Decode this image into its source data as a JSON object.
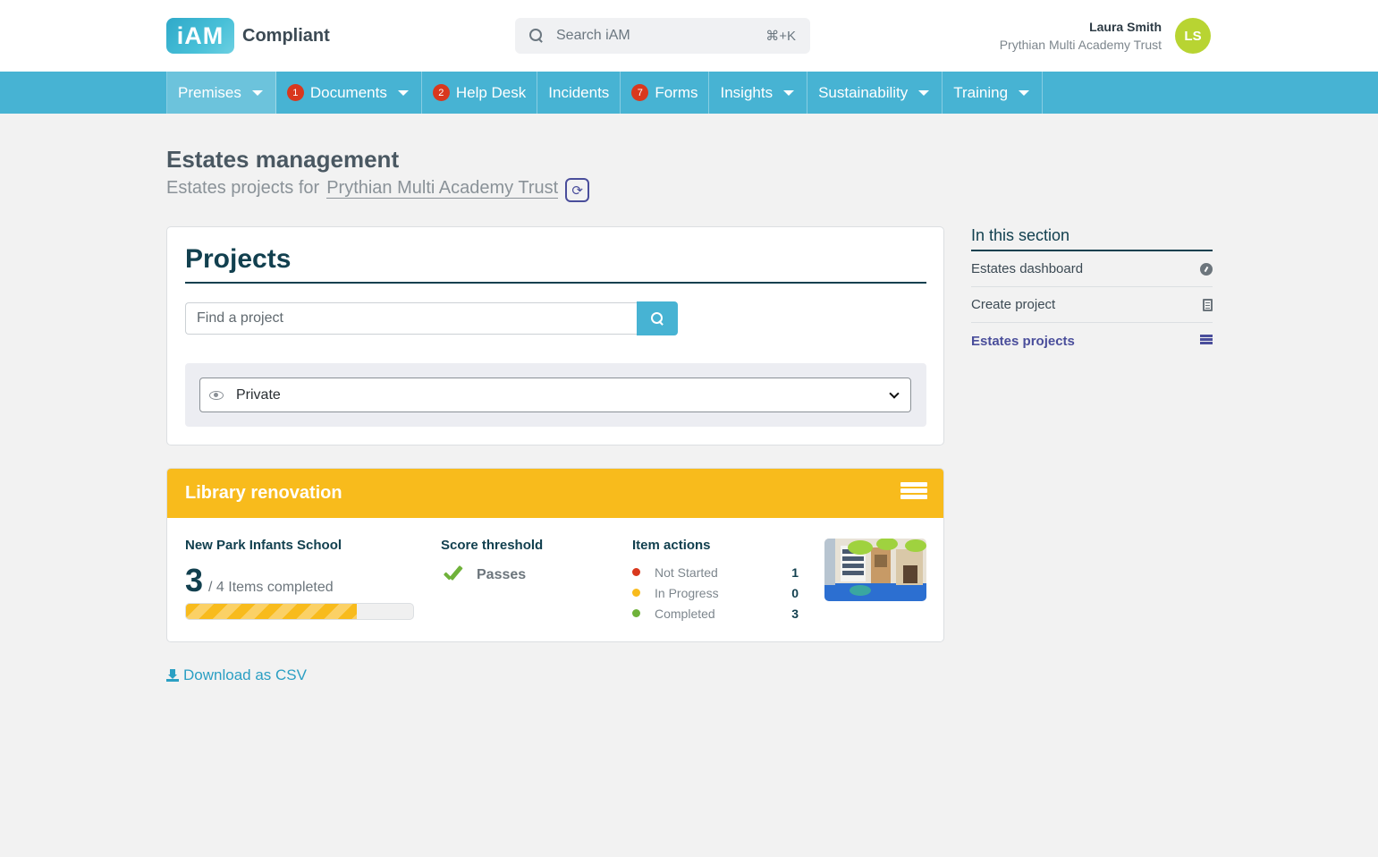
{
  "header": {
    "logo_mark": "iAM",
    "logo_text": "Compliant",
    "search_placeholder": "Search iAM",
    "search_shortcut": "⌘+K",
    "user_name": "Laura Smith",
    "user_org": "Prythian Multi Academy Trust",
    "avatar_initials": "LS"
  },
  "nav": {
    "items": [
      {
        "label": "Premises",
        "badge": "",
        "caret": true
      },
      {
        "label": "Documents",
        "badge": "1",
        "caret": true
      },
      {
        "label": "Help Desk",
        "badge": "2",
        "caret": false
      },
      {
        "label": "Incidents",
        "badge": "",
        "caret": false
      },
      {
        "label": "Forms",
        "badge": "7",
        "caret": false
      },
      {
        "label": "Insights",
        "badge": "",
        "caret": true
      },
      {
        "label": "Sustainability",
        "badge": "",
        "caret": true
      },
      {
        "label": "Training",
        "badge": "",
        "caret": true
      }
    ]
  },
  "page": {
    "title": "Estates management",
    "subtitle_prefix": "Estates projects for",
    "subtitle_org": "Prythian Multi Academy Trust"
  },
  "projects": {
    "heading": "Projects",
    "search_placeholder": "Find a project",
    "visibility_selected": "Private"
  },
  "project_card": {
    "title": "Library renovation",
    "school": "New Park Infants School",
    "completed": "3",
    "total_text": "/ 4 Items completed",
    "progress_fraction": 0.75,
    "threshold_title": "Score threshold",
    "threshold_status": "Passes",
    "actions_title": "Item actions",
    "actions": [
      {
        "label": "Not Started",
        "value": "1",
        "color": "#d9381e"
      },
      {
        "label": "In Progress",
        "value": "0",
        "color": "#f8bb1c"
      },
      {
        "label": "Completed",
        "value": "3",
        "color": "#6fb23a"
      }
    ]
  },
  "download_label": "Download as CSV",
  "sidebar": {
    "title": "In this section",
    "items": [
      {
        "label": "Estates dashboard",
        "icon": "dashboard-icon"
      },
      {
        "label": "Create project",
        "icon": "document-icon"
      },
      {
        "label": "Estates projects",
        "icon": "list-icon"
      }
    ]
  },
  "colors": {
    "nav": "#47b3d3",
    "accent_yellow": "#f8bb1c",
    "heading": "#12404f",
    "avatar": "#b8d432"
  }
}
